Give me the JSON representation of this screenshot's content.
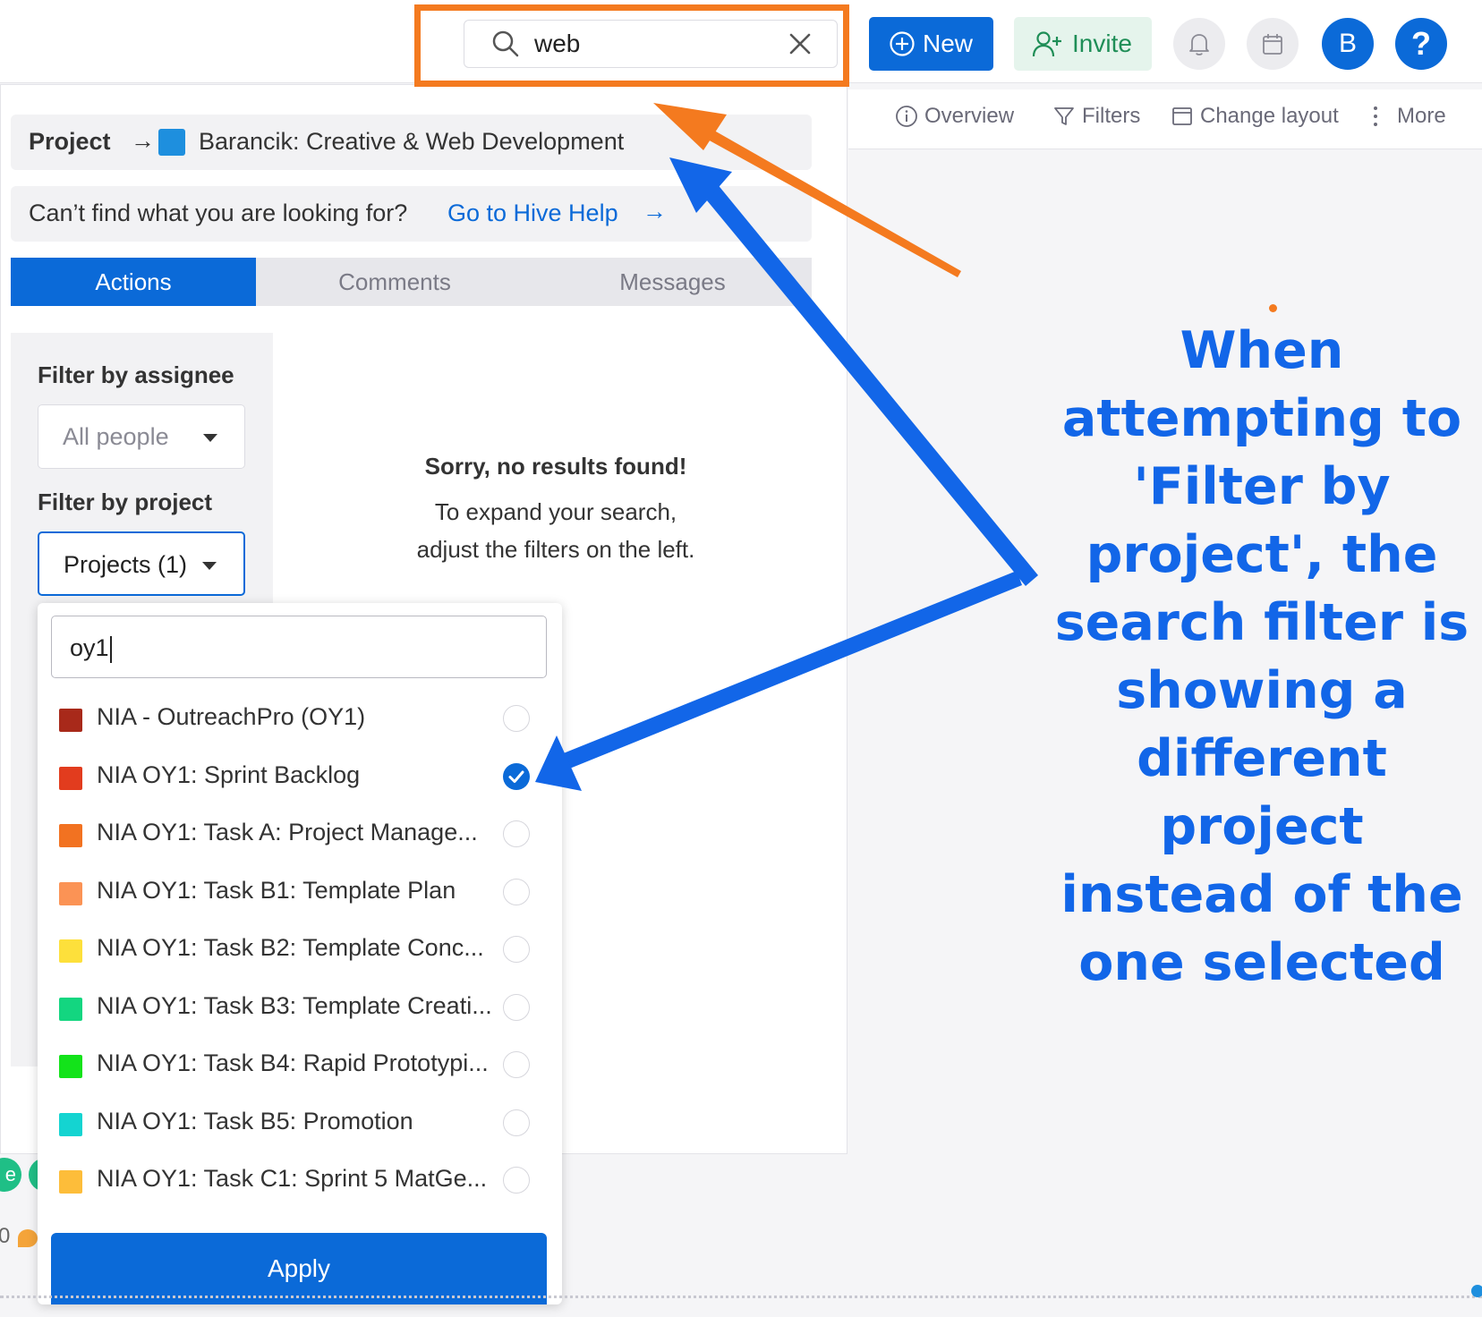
{
  "header": {
    "search_value": "web",
    "new_label": "New",
    "invite_label": "Invite",
    "avatar_initial": "B",
    "help_label": "?"
  },
  "toolbar": {
    "overview": "Overview",
    "filters": "Filters",
    "change_layout": "Change layout",
    "more": "More"
  },
  "breadcrumb": {
    "label": "Project",
    "arrow": "→",
    "project_name": "Barancik: Creative & Web Development",
    "project_color": "#1e8fde"
  },
  "help": {
    "question": "Can’t find what you are looking for?",
    "link": "Go to Hive Help",
    "arrow": "→"
  },
  "tabs": [
    {
      "label": "Actions",
      "active": true
    },
    {
      "label": "Comments",
      "active": false
    },
    {
      "label": "Messages",
      "active": false
    }
  ],
  "filters": {
    "assignee_label": "Filter by assignee",
    "assignee_value": "All people",
    "project_label": "Filter by project",
    "project_value": "Projects (1)"
  },
  "no_results": {
    "title": "Sorry, no results found!",
    "line1": "To expand your search,",
    "line2": "adjust the filters on the left."
  },
  "project_dropdown": {
    "search_value": "oy1",
    "items": [
      {
        "name": "NIA - OutreachPro (OY1)",
        "color": "#a8291a",
        "selected": false
      },
      {
        "name": "NIA OY1: Sprint Backlog",
        "color": "#e23c1e",
        "selected": true
      },
      {
        "name": "NIA OY1: Task A: Project Manage...",
        "color": "#f27221",
        "selected": false
      },
      {
        "name": "NIA OY1: Task B1: Template Plan",
        "color": "#fb9355",
        "selected": false
      },
      {
        "name": "NIA OY1: Task B2: Template Conc...",
        "color": "#fde03b",
        "selected": false
      },
      {
        "name": "NIA OY1: Task B3: Template Creati...",
        "color": "#13d680",
        "selected": false
      },
      {
        "name": "NIA OY1: Task B4: Rapid Prototypi...",
        "color": "#13e31a",
        "selected": false
      },
      {
        "name": "NIA OY1: Task B5: Promotion",
        "color": "#14d4d1",
        "selected": false
      },
      {
        "name": "NIA OY1: Task C1: Sprint 5 MatGe...",
        "color": "#fdbd3a",
        "selected": false
      }
    ],
    "apply_label": "Apply"
  },
  "annotation": {
    "lines": [
      "When",
      "attempting to",
      "'Filter by",
      "project', the",
      "search filter is",
      "showing a",
      "different project",
      "instead of the",
      "one selected"
    ],
    "color": "#1266e8",
    "highlight_color": "#f47a1f"
  },
  "background_edge": {
    "chip_text": "e",
    "count": "0"
  }
}
